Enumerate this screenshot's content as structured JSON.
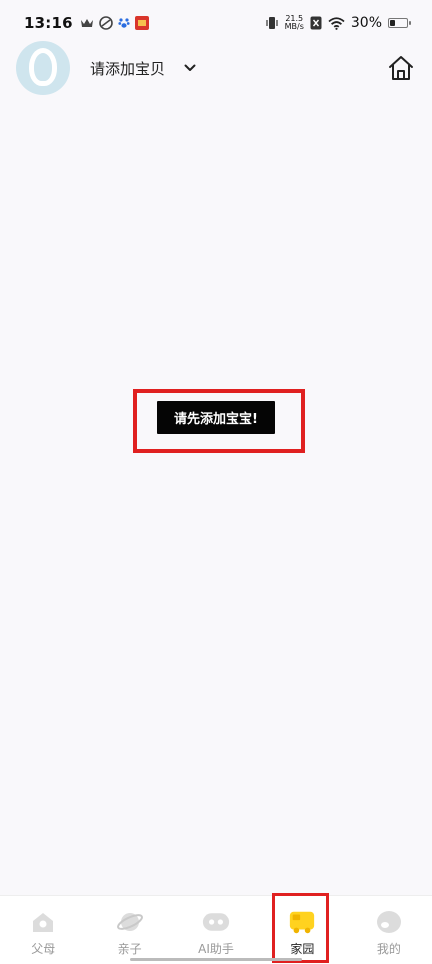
{
  "status_bar": {
    "time": "13:16",
    "net_speed_value": "21.5",
    "net_speed_unit": "MB/s",
    "battery_percent": "30%",
    "battery_level": 0.3
  },
  "header": {
    "baby_name": "请添加宝贝"
  },
  "prompt": {
    "message": "请先添加宝宝!"
  },
  "tabs": [
    {
      "label": "父母",
      "icon": "parents-icon",
      "active": false
    },
    {
      "label": "亲子",
      "icon": "planet-icon",
      "active": false
    },
    {
      "label": "AI助手",
      "icon": "robot-icon",
      "active": false
    },
    {
      "label": "家园",
      "icon": "school-bus-icon",
      "active": true
    },
    {
      "label": "我的",
      "icon": "profile-icon",
      "active": false
    }
  ],
  "colors": {
    "accent": "#ffd21f",
    "highlight": "#e02020",
    "toast_bg": "#050505",
    "avatar_bg": "#cfe5ee"
  }
}
